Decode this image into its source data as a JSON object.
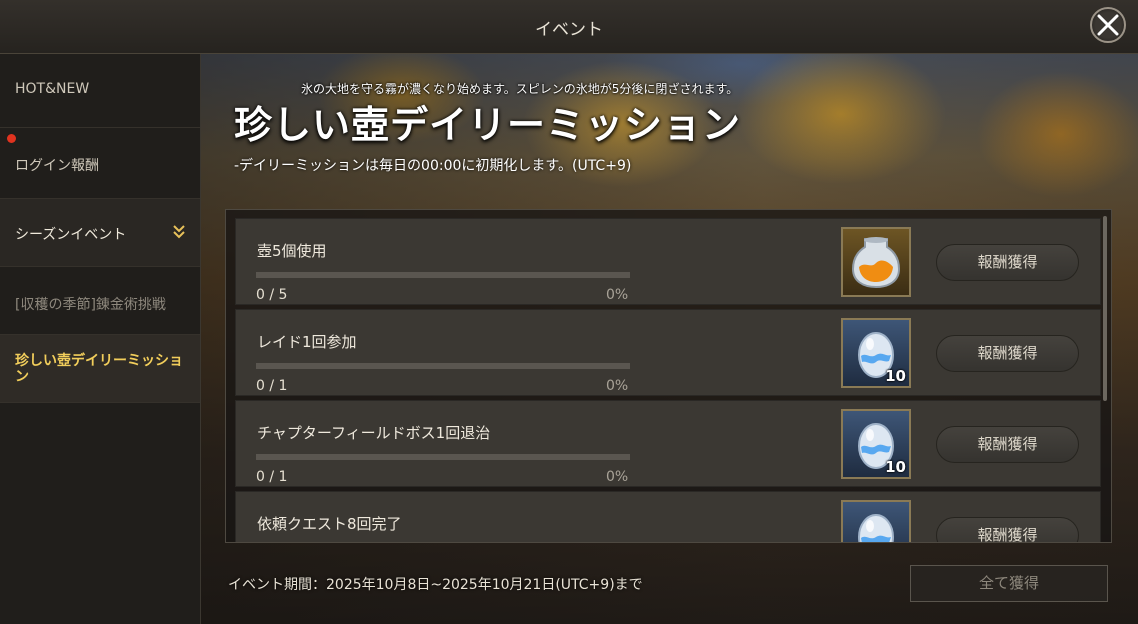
{
  "window": {
    "title": "イベント"
  },
  "sidebar": {
    "items": [
      {
        "label": "HOT&NEW"
      },
      {
        "label": "ログイン報酬"
      },
      {
        "label": "シーズンイベント"
      },
      {
        "label": "[収穫の季節]錬金術挑戦"
      },
      {
        "label": "珍しい壺デイリーミッション"
      }
    ]
  },
  "event": {
    "notice": "氷の大地を守る霧が濃くなり始めます。スピレンの氷地が5分後に閉ざされます。",
    "title": "珍しい壺デイリーミッション",
    "reset_note": "-デイリーミッションは毎日の00:00に初期化します。(UTC+9)",
    "period": "イベント期間：2025年10月8日~2025年10月21日(UTC+9)まで",
    "claim_all_label": "全て獲得"
  },
  "missions": [
    {
      "name": "壺5個使用",
      "count": "0 / 5",
      "percent": "0%",
      "progress": 0,
      "reward_icon": "orange-jar-icon",
      "reward_qty": "",
      "claim_label": "報酬獲得"
    },
    {
      "name": "レイド1回参加",
      "count": "0 / 1",
      "percent": "0%",
      "progress": 0,
      "reward_icon": "crystal-egg-icon",
      "reward_qty": "10",
      "claim_label": "報酬獲得"
    },
    {
      "name": "チャプターフィールドボス1回退治",
      "count": "0 / 1",
      "percent": "0%",
      "progress": 0,
      "reward_icon": "crystal-egg-icon",
      "reward_qty": "10",
      "claim_label": "報酬獲得"
    },
    {
      "name": "依頼クエスト8回完了",
      "count": "",
      "percent": "",
      "progress": 0,
      "reward_icon": "crystal-egg-icon",
      "reward_qty": "",
      "claim_label": "報酬獲得"
    }
  ],
  "colors": {
    "accent": "#f2ce5b",
    "notification": "#e0331f"
  }
}
